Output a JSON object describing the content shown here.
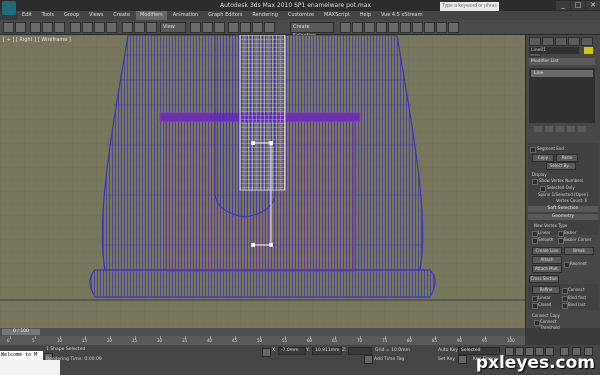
{
  "window": {
    "title": "Autodesk 3ds Max  2010 SP1     enamelware pot.max",
    "search_placeholder": "Type a keyword or phrase",
    "buttons": [
      "_",
      "□",
      "✕"
    ]
  },
  "menu": [
    "Edit",
    "Tools",
    "Group",
    "Views",
    "Create",
    "Modifiers",
    "Animation",
    "Graph Editors",
    "Rendering",
    "Customize",
    "MAXScript",
    "Help",
    "Vue 4.5 xStream"
  ],
  "menu_active": "Modifiers",
  "toolbar": {
    "view_select": "View",
    "selection_set": "Create Selection"
  },
  "viewport": {
    "label": "[ + ] [ Right ] [ Wireframe ]",
    "wire_color": "#3b34c0",
    "selected_color": "#8a30d0",
    "bg_color": "#76775c"
  },
  "command_panel": {
    "object_name": "Line01",
    "object_color": "#d5c600",
    "modifier_list": "Modifier List",
    "stack_item": "Line",
    "selection": {
      "named": "Segment End",
      "copy": "Copy",
      "paste": "Paste",
      "select_by": "Select By...",
      "display_label": "Display",
      "show_vertex_numbers": "Show Vertex Numbers",
      "selected_only": "Selected Only",
      "status1": "Spline 1/Selected [Open]",
      "status2": "Vertex Count: 6"
    },
    "soft_selection": "Soft Selection",
    "geometry": "Geometry",
    "new_vertex_type": "New Vertex Type",
    "vertex_types": [
      "Linear",
      "Bezier",
      "Smooth",
      "Bezier Corner"
    ],
    "create_line": "Create Line",
    "break": "Break",
    "attach": "Attach",
    "reorient": "Reorient",
    "attach_mult": "Attach Mult.",
    "cross_section": "Cross Section",
    "refine": "Refine",
    "connect": "Connect",
    "linear": "Linear",
    "bind_first": "Bind first",
    "closed": "Closed",
    "bind_last": "Bind last",
    "connect_copy": "Connect Copy",
    "connect2": "Connect",
    "threshold": "Threshold"
  },
  "timeline": {
    "slider": "0 / 100",
    "ticks": [
      "0",
      "5",
      "10",
      "15",
      "20",
      "25",
      "30",
      "35",
      "40",
      "45",
      "50",
      "55",
      "60",
      "65",
      "70",
      "75",
      "80",
      "85",
      "90",
      "95",
      "100"
    ]
  },
  "status": {
    "maxscript": "Welcome to M",
    "selected": "1 Shape Selected",
    "render_time": "Rendering Time: 0:00:09",
    "x_label": "X:",
    "x_value": "-7.0mm",
    "y_label": "Y:",
    "y_value": "10.911mm",
    "z_label": "Z:",
    "z_value": "",
    "grid": "Grid = 10.0mm",
    "add_time_tag": "Add Time Tag",
    "auto_key": "Auto Key",
    "set_key": "Set Key",
    "key_filters": "Key Filters...",
    "selected_dropdown": "Selected"
  },
  "watermark": "pxleyes.com"
}
